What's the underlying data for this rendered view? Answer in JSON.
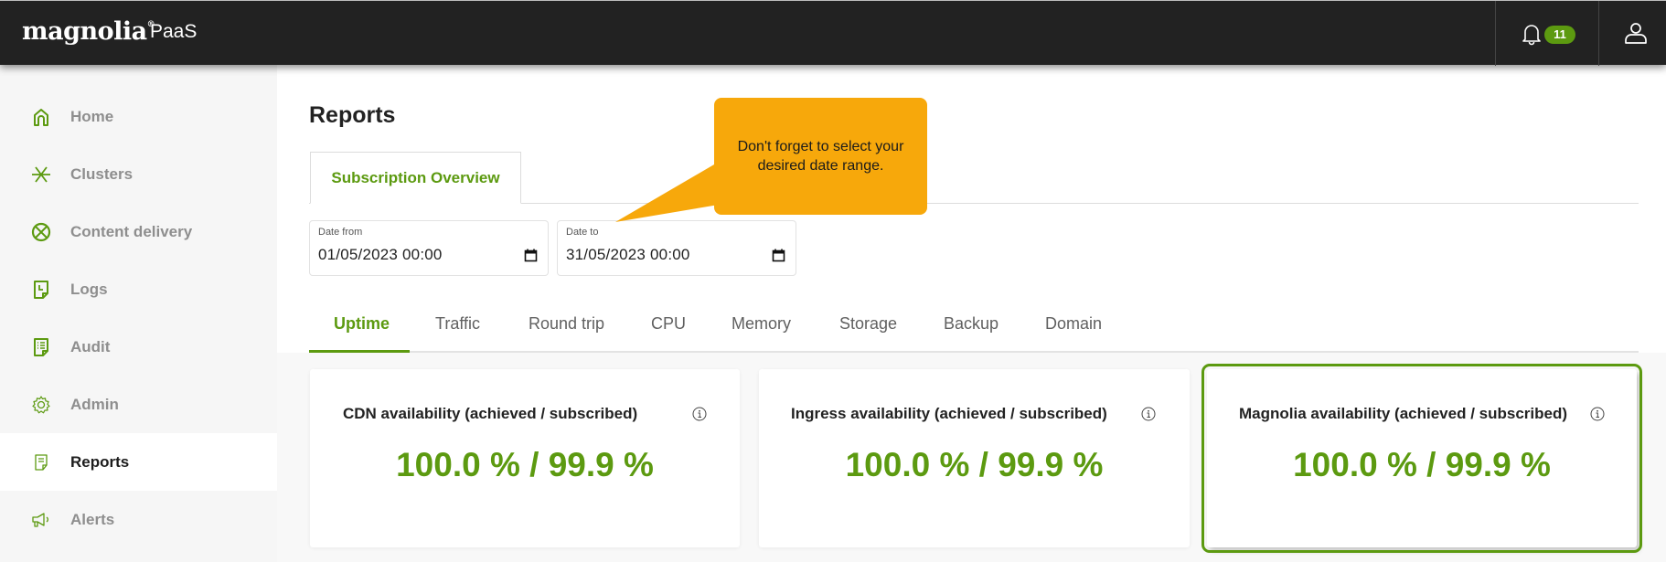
{
  "header": {
    "brand": "magnolia",
    "brand_mark": "®",
    "product": "PaaS",
    "notifications_count": "11"
  },
  "sidebar": {
    "items": [
      {
        "label": "Home",
        "icon": "home-icon",
        "active": false
      },
      {
        "label": "Clusters",
        "icon": "clusters-icon",
        "active": false
      },
      {
        "label": "Content delivery",
        "icon": "globe-icon",
        "active": false
      },
      {
        "label": "Logs",
        "icon": "logs-icon",
        "active": false
      },
      {
        "label": "Audit",
        "icon": "audit-icon",
        "active": false
      },
      {
        "label": "Admin",
        "icon": "gear-icon",
        "active": false
      },
      {
        "label": "Reports",
        "icon": "report-icon",
        "active": true
      },
      {
        "label": "Alerts",
        "icon": "megaphone-icon",
        "active": false
      }
    ]
  },
  "main": {
    "title": "Reports",
    "sub_tab": "Subscription Overview",
    "date_from": {
      "label": "Date from",
      "value": "01/05/2023 00:00"
    },
    "date_to": {
      "label": "Date to",
      "value": "31/05/2023 00:00"
    },
    "callout": "Don't forget to select your desired date range.",
    "tabs": [
      "Uptime",
      "Traffic",
      "Round trip",
      "CPU",
      "Memory",
      "Storage",
      "Backup",
      "Domain"
    ],
    "active_tab": "Uptime",
    "cards": [
      {
        "title": "CDN availability (achieved / subscribed)",
        "value": "100.0 % / 99.9 %"
      },
      {
        "title": "Ingress availability (achieved / subscribed)",
        "value": "100.0 % / 99.9 %"
      },
      {
        "title": "Magnolia availability (achieved / subscribed)",
        "value": "100.0 % / 99.9 %",
        "highlighted": true
      }
    ]
  },
  "colors": {
    "accent": "#5c9a10",
    "topbar": "#222222",
    "callout": "#f7a80b"
  }
}
